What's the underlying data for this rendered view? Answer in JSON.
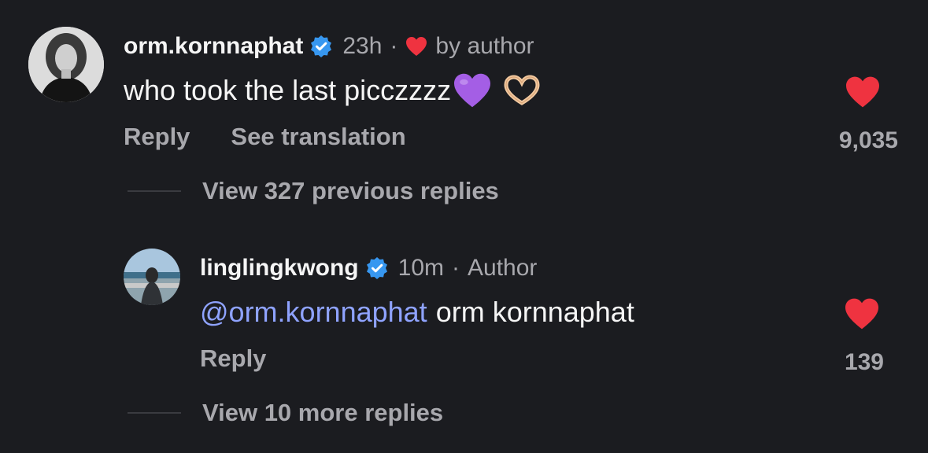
{
  "comment": {
    "username": "orm.kornnaphat",
    "time": "23h",
    "separator": "·",
    "liked_by_author_label": "by author",
    "text": "who took the last picczzzz",
    "reply_label": "Reply",
    "translate_label": "See translation",
    "like_count": "9,035",
    "view_previous_label": "View 327 previous replies"
  },
  "reply": {
    "username": "linglingkwong",
    "time": "10m",
    "separator": "·",
    "author_label": "Author",
    "mention": "@orm.kornnaphat",
    "text": "orm kornnaphat",
    "reply_label": "Reply",
    "like_count": "139",
    "view_more_label": "View 10 more replies"
  },
  "colors": {
    "background": "#1b1c20",
    "like_red": "#ef3340",
    "verified_blue": "#3797f0",
    "mention_blue": "#8fa3ff",
    "heart_purple": "#a45ee5"
  },
  "icons": {
    "verified": "verified-badge-icon",
    "like": "heart-icon",
    "emoji_purple_heart": "purple-heart-emoji",
    "emoji_heart_hands": "heart-hands-emoji"
  }
}
